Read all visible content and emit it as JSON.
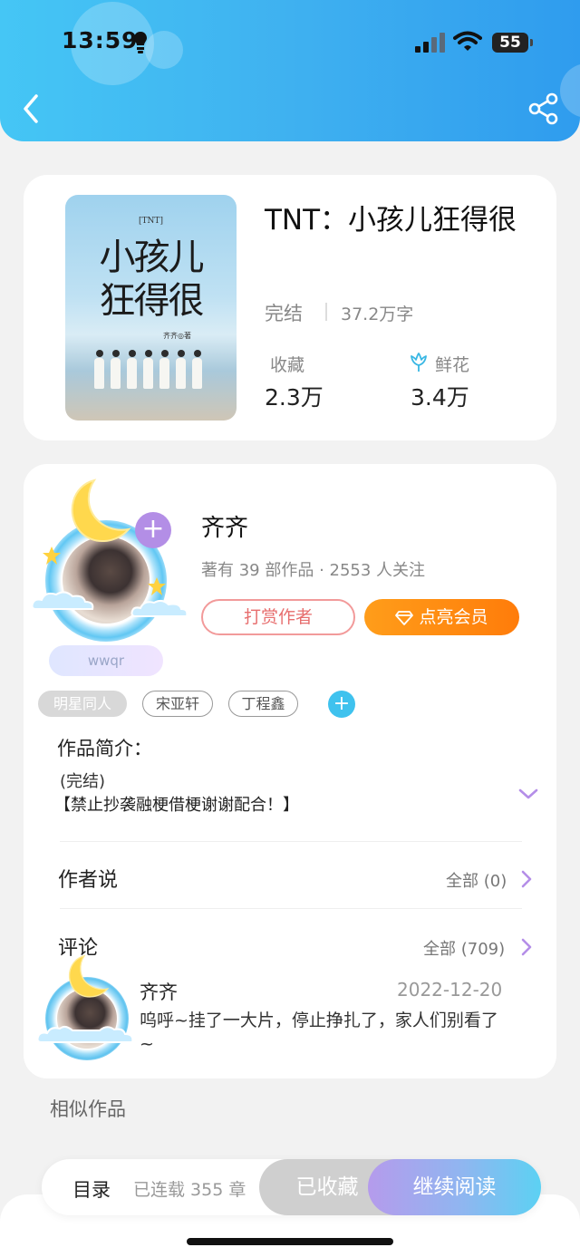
{
  "status_bar": {
    "time": "13:59",
    "battery": "55"
  },
  "book": {
    "title": "TNT：小孩儿狂得很",
    "status": "完结",
    "word_count": "37.2万字",
    "cover": {
      "series_tag": "[TNT]",
      "title_line1": "小孩儿",
      "title_line2": "狂得很",
      "author": "齐齐◎著"
    },
    "favorites": {
      "label": "收藏",
      "value": "2.3万"
    },
    "flowers": {
      "label": "鲜花",
      "value": "3.4万"
    }
  },
  "author": {
    "name": "齐齐",
    "meta": "著有 39 部作品 · 2553 人关注",
    "nickname_tag": "wwqr",
    "tip_label": "打赏作者",
    "vip_label": "点亮会员"
  },
  "tags": [
    "明星同人",
    "宋亚轩",
    "丁程鑫"
  ],
  "intro": {
    "title": "作品简介：",
    "line1": "(完结)",
    "line2": "【禁止抄袭融梗借梗谢谢配合！】"
  },
  "author_says": {
    "title": "作者说",
    "more": "全部 (0)"
  },
  "comments": {
    "title": "评论",
    "more": "全部 (709)",
    "first": {
      "name": "齐齐",
      "date": "2022-12-20",
      "text": "呜呼~挂了一大片，停止挣扎了，家人们别看了~"
    }
  },
  "similar_title": "相似作品",
  "bottom_bar": {
    "toc_label": "目录",
    "toc_count": "已连载 355 章",
    "favorited_label": "已收藏",
    "continue_label": "继续阅读"
  },
  "colors": {
    "header_gradient": [
      "#45c6f5",
      "#2f9cee"
    ],
    "vip_orange": "#ff8c12",
    "tip_red": "#e76e6e",
    "accent_blue": "#3fc2ee",
    "accent_purple": "#b38ee6"
  },
  "icons": {
    "back": "chevron-left-icon",
    "share": "share-icon",
    "flower": "flower-icon",
    "vip": "diamond-icon",
    "expand": "chevron-down-icon",
    "more": "chevron-right-icon"
  }
}
